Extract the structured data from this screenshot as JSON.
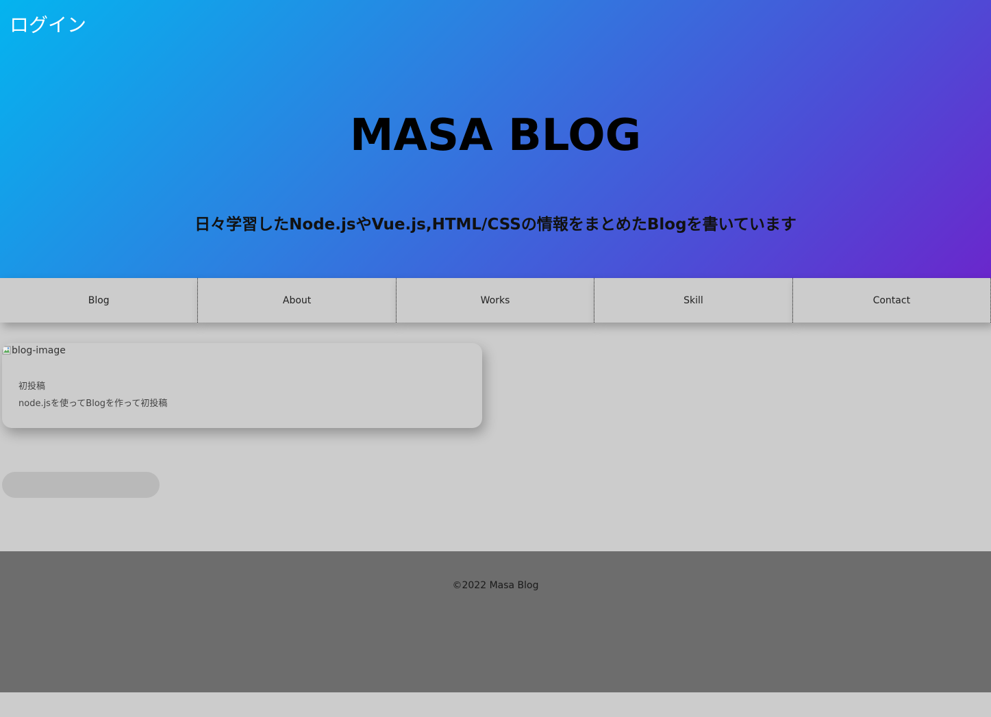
{
  "header": {
    "login_label": "ログイン",
    "site_title": "MASA BLOG",
    "subtitle": "日々学習したNode.jsやVue.js,HTML/CSSの情報をまとめたBlogを書いています"
  },
  "nav": {
    "items": [
      {
        "label": "Blog"
      },
      {
        "label": "About"
      },
      {
        "label": "Works"
      },
      {
        "label": "Skill"
      },
      {
        "label": "Contact"
      }
    ]
  },
  "posts": [
    {
      "image_alt": "blog-image",
      "title": "初投稿",
      "description": "node.jsを使ってBlogを作って初投稿"
    }
  ],
  "footer": {
    "copyright": "©2022 Masa Blog"
  },
  "colors": {
    "gradient_start": "#04b4ef",
    "gradient_end": "#6a27cc",
    "page_background": "#cccccc",
    "footer_background": "#6d6d6d"
  },
  "icons": {
    "broken_image": "broken-image-icon"
  }
}
